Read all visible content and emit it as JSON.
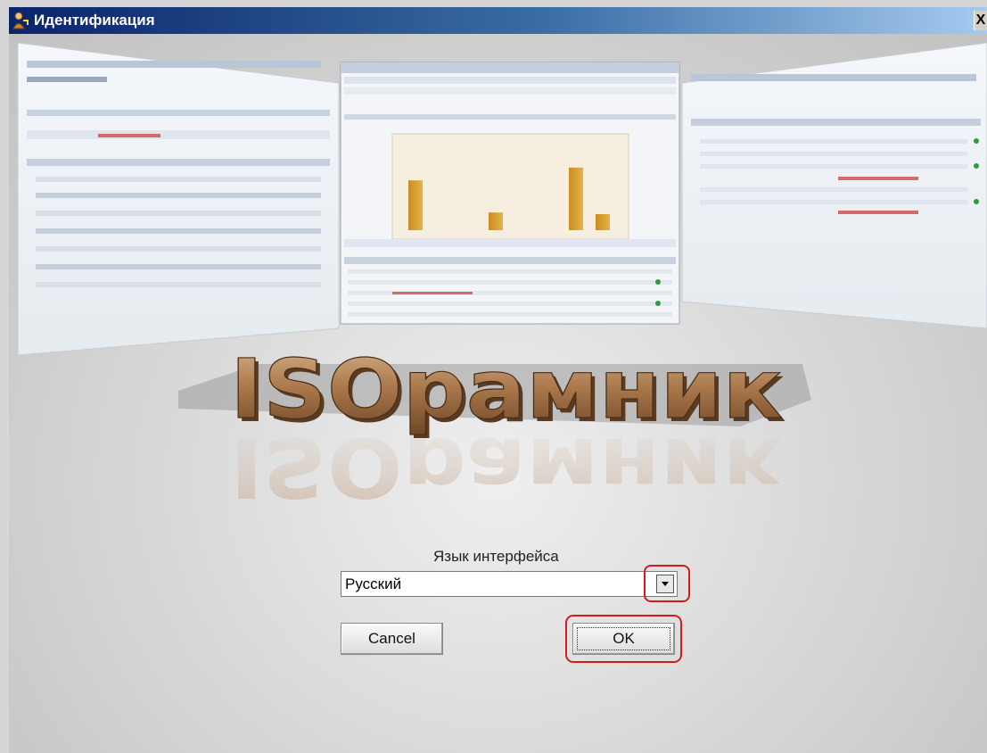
{
  "window": {
    "title": "Идентификация",
    "close_glyph": "X",
    "title_icon": "keys-person-icon"
  },
  "splash": {
    "logo_text": "ISOрамник",
    "logo_reflection_text": "ISOрамник",
    "panel_chart_values": [
      62,
      0,
      0,
      22,
      0,
      0,
      78,
      20
    ]
  },
  "language": {
    "label": "Язык интерфейса",
    "selected": "Русский",
    "dropdown_icon": "dropdown-arrow-icon"
  },
  "buttons": {
    "cancel": "Cancel",
    "ok": "OK"
  },
  "colors": {
    "highlight": "#d21c1c",
    "titlebar_start": "#0a246a",
    "titlebar_end": "#a6caf0",
    "logo": "#a8764a"
  }
}
